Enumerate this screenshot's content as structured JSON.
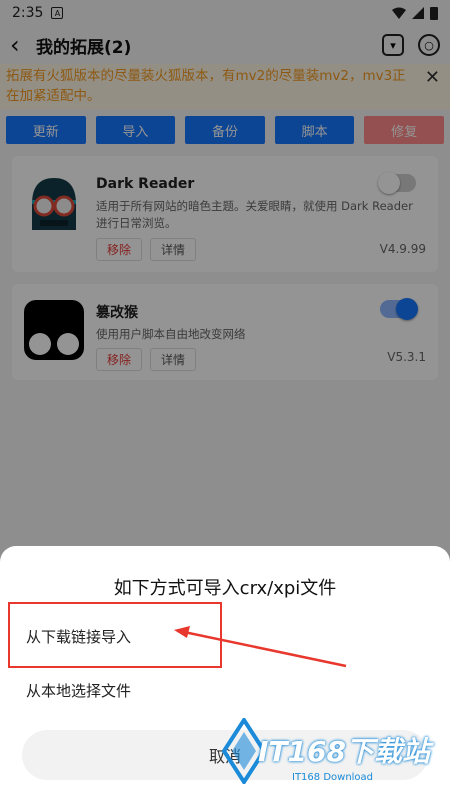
{
  "status_bar": {
    "time": "2:35",
    "noti_icon": "A"
  },
  "app_bar": {
    "title": "我的拓展(2)"
  },
  "notice": {
    "text": "拓展有火狐版本的尽量装火狐版本，有mv2的尽量装mv2，mv3正在加紧适配中。"
  },
  "toolbar": {
    "buttons": [
      "更新",
      "导入",
      "备份",
      "脚本",
      "修复"
    ]
  },
  "extensions": [
    {
      "name": "Dark Reader",
      "desc": "适用于所有网站的暗色主题。关爱眼睛，就使用 Dark Reader 进行日常浏览。",
      "remove": "移除",
      "details": "详情",
      "version": "V4.9.99",
      "enabled": false
    },
    {
      "name": "篡改猴",
      "desc": "使用用户脚本自由地改变网络",
      "remove": "移除",
      "details": "详情",
      "version": "V5.3.1",
      "enabled": true
    }
  ],
  "sheet": {
    "title": "如下方式可导入crx/xpi文件",
    "option_link": "从下载链接导入",
    "option_local": "从本地选择文件",
    "cancel": "取消"
  },
  "watermark": {
    "brand": "IT168下载站",
    "sub": "IT168 Download"
  },
  "colors": {
    "primary": "#1677ff",
    "repair": "#ff8a8a",
    "notice": "#f39a1f",
    "highlight": "#e8372c"
  }
}
